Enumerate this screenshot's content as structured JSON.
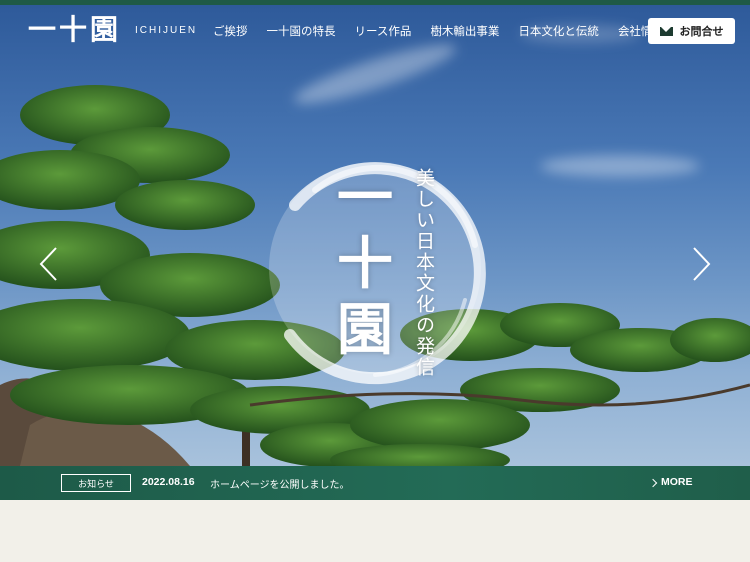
{
  "logo": {
    "mark": "一十園",
    "sub": "ICHIJUEN"
  },
  "nav": {
    "items": [
      "ご挨拶",
      "一十園の特長",
      "リース作品",
      "樹木輸出事業",
      "日本文化と伝統",
      "会社情報"
    ],
    "contact_label": "お問合せ"
  },
  "hero": {
    "brand": "一十園",
    "tagline": "美しい日本文化の発信",
    "prev_icon": "chevron-left-icon",
    "next_icon": "chevron-right-icon"
  },
  "news": {
    "badge": "お知らせ",
    "date": "2022.08.16",
    "text": "ホームページを公開しました。",
    "more": "MORE"
  },
  "colors": {
    "brand_green": "#1f5a46",
    "sky": "#3e6eae",
    "pine": "#3b7a2a"
  }
}
